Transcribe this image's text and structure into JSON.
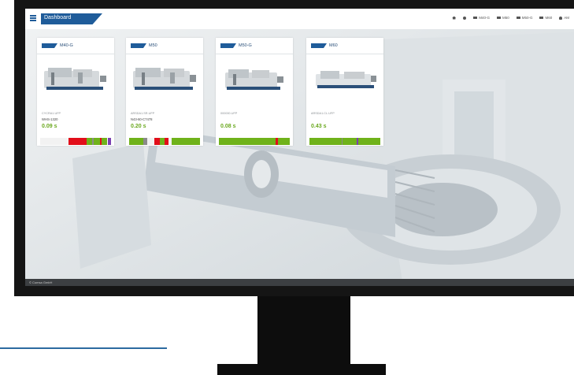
{
  "header": {
    "title": "Dashboard",
    "nav": [
      {
        "icon": "home-icon",
        "label": ""
      },
      {
        "icon": "gear-icon",
        "label": ""
      },
      {
        "icon": "grid-icon",
        "label": "M40-G"
      },
      {
        "icon": "grid-icon",
        "label": "M50"
      },
      {
        "icon": "grid-icon",
        "label": "M50-G"
      },
      {
        "icon": "grid-icon",
        "label": "M60"
      },
      {
        "icon": "user-icon",
        "label": "AM"
      }
    ]
  },
  "machines": [
    {
      "name": "M40-G",
      "program": "CYCRA1.UFP",
      "part": "WHS-1320",
      "cycle": "0.09 s",
      "timeline": [
        {
          "color": "#f2f2f2",
          "fraction": 0.4
        },
        {
          "color": "#e20e1a",
          "fraction": 0.25
        },
        {
          "color": "#6fb21a",
          "fraction": 0.08
        },
        {
          "color": "#8a8a8a",
          "fraction": 0.03
        },
        {
          "color": "#6fb21a",
          "fraction": 0.08
        },
        {
          "color": "#e20e1a",
          "fraction": 0.03
        },
        {
          "color": "#6fb21a",
          "fraction": 0.08
        },
        {
          "color": "#7a3fb0",
          "fraction": 0.05
        }
      ]
    },
    {
      "name": "M50",
      "program": "ARSDA1.SR.UFP",
      "part": "N43-60-C7478",
      "cycle": "0.20 s",
      "timeline": [
        {
          "color": "#6fb21a",
          "fraction": 0.2
        },
        {
          "color": "#8a8a8a",
          "fraction": 0.05
        },
        {
          "color": "#f2f2f2",
          "fraction": 0.1
        },
        {
          "color": "#e20e1a",
          "fraction": 0.08
        },
        {
          "color": "#6fb21a",
          "fraction": 0.07
        },
        {
          "color": "#e20e1a",
          "fraction": 0.05
        },
        {
          "color": "#f2f2f2",
          "fraction": 0.05
        },
        {
          "color": "#6fb21a",
          "fraction": 0.4
        }
      ]
    },
    {
      "name": "M50-G",
      "program": "000000.UFP",
      "part": "",
      "cycle": "0.08 s",
      "timeline": [
        {
          "color": "#6fb21a",
          "fraction": 0.8
        },
        {
          "color": "#e20e1a",
          "fraction": 0.03
        },
        {
          "color": "#6fb21a",
          "fraction": 0.17
        }
      ]
    },
    {
      "name": "M60",
      "program": "ARSDA1.CL.UFP",
      "part": "",
      "cycle": "0.43 s",
      "timeline": [
        {
          "color": "#6fb21a",
          "fraction": 0.45
        },
        {
          "color": "#8a8a8a",
          "fraction": 0.02
        },
        {
          "color": "#6fb21a",
          "fraction": 0.2
        },
        {
          "color": "#7a3fb0",
          "fraction": 0.02
        },
        {
          "color": "#6fb21a",
          "fraction": 0.31
        }
      ]
    }
  ],
  "footer": {
    "copyright": "© Cumsa GmbH"
  },
  "colors": {
    "brand": "#1f5c9a",
    "ok": "#6fb21a",
    "alarm": "#e20e1a",
    "idle": "#8a8a8a"
  }
}
